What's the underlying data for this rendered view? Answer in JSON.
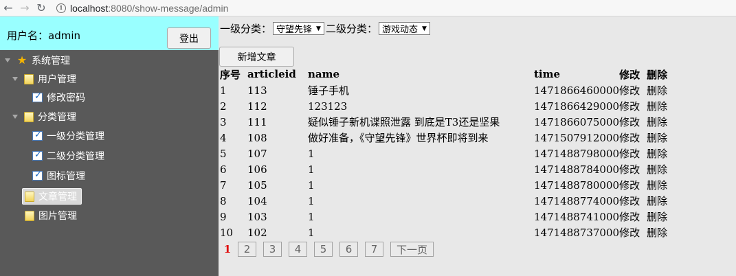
{
  "browser": {
    "url_host": "localhost",
    "url_rest": ":8080/show-message/admin"
  },
  "sidebar": {
    "user_label": "用户名：admin",
    "logout_label": "登出",
    "items": [
      {
        "label": "系统管理"
      },
      {
        "label": "用户管理"
      },
      {
        "label": "修改密码"
      },
      {
        "label": "分类管理"
      },
      {
        "label": "一级分类管理"
      },
      {
        "label": "二级分类管理"
      },
      {
        "label": "图标管理"
      },
      {
        "label": "文章管理"
      },
      {
        "label": "图片管理"
      }
    ]
  },
  "filters": {
    "level1_label": "一级分类：",
    "level1_value": "守望先锋",
    "level2_label": "二级分类：",
    "level2_value": "游戏动态"
  },
  "actions": {
    "add_article": "新增文章"
  },
  "table": {
    "headers": [
      "序号",
      "articleid",
      "name",
      "time",
      "修改",
      "删除"
    ],
    "rows": [
      {
        "idx": "1",
        "id": "113",
        "name": "锤子手机",
        "time": "1471866460000",
        "edit": "修改",
        "del": "删除"
      },
      {
        "idx": "2",
        "id": "112",
        "name": "123123",
        "time": "1471866429000",
        "edit": "修改",
        "del": "删除"
      },
      {
        "idx": "3",
        "id": "111",
        "name": "疑似锤子新机谍照泄露 到底是T3还是坚果",
        "time": "1471866075000",
        "edit": "修改",
        "del": "删除"
      },
      {
        "idx": "4",
        "id": "108",
        "name": "做好准备，《守望先锋》世界杯即将到来",
        "time": "1471507912000",
        "edit": "修改",
        "del": "删除"
      },
      {
        "idx": "5",
        "id": "107",
        "name": "1",
        "time": "1471488798000",
        "edit": "修改",
        "del": "删除"
      },
      {
        "idx": "6",
        "id": "106",
        "name": "1",
        "time": "1471488784000",
        "edit": "修改",
        "del": "删除"
      },
      {
        "idx": "7",
        "id": "105",
        "name": "1",
        "time": "1471488780000",
        "edit": "修改",
        "del": "删除"
      },
      {
        "idx": "8",
        "id": "104",
        "name": "1",
        "time": "1471488774000",
        "edit": "修改",
        "del": "删除"
      },
      {
        "idx": "9",
        "id": "103",
        "name": "1",
        "time": "1471488741000",
        "edit": "修改",
        "del": "删除"
      },
      {
        "idx": "10",
        "id": "102",
        "name": "1",
        "time": "1471488737000",
        "edit": "修改",
        "del": "删除"
      }
    ]
  },
  "pager": {
    "current": "1",
    "pages": [
      "2",
      "3",
      "4",
      "5",
      "6",
      "7"
    ],
    "next": "下一页"
  }
}
